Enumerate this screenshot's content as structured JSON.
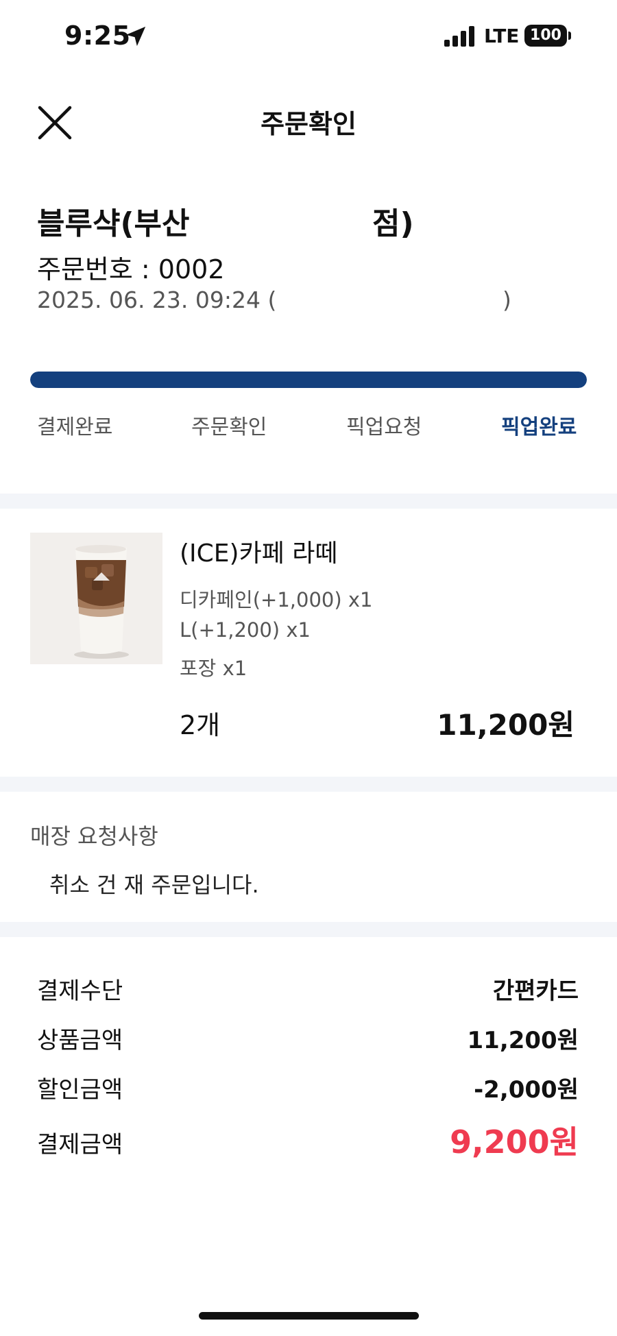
{
  "status_bar": {
    "time": "9:25",
    "network": "LTE",
    "battery": "100"
  },
  "header": {
    "title": "주문확인",
    "close_icon": "close-icon"
  },
  "store": {
    "name": "블루샥(부산",
    "name_suffix": "점)",
    "order_number": "주문번호 : 0002",
    "datetime": "2025. 06. 23. 09:24 (",
    "datetime_close": ")"
  },
  "progress": {
    "fraction": 1.0,
    "color": "#14407e",
    "steps": [
      {
        "label": "결제완료",
        "active": false
      },
      {
        "label": "주문확인",
        "active": false
      },
      {
        "label": "픽업요청",
        "active": false
      },
      {
        "label": "픽업완료",
        "active": true
      }
    ]
  },
  "item": {
    "name": "(ICE)카페 라떼",
    "options": [
      "디카페인(+1,000) x1",
      "L(+1,200) x1",
      "포장 x1"
    ],
    "quantity": "2개",
    "price": "11,200원",
    "image": "iced-cafe-latte-image"
  },
  "request": {
    "label": "매장 요청사항",
    "text": "취소 건 재 주문입니다."
  },
  "payment": {
    "rows": [
      {
        "label": "결제수단",
        "value": "간편카드"
      },
      {
        "label": "상품금액",
        "value": "11,200원"
      },
      {
        "label": "할인금액",
        "value": "-2,000원"
      }
    ],
    "total_label": "결제금액",
    "total_value": "9,200원",
    "total_color": "#ef3b50"
  }
}
